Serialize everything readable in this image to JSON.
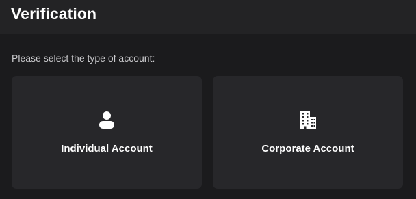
{
  "header": {
    "title": "Verification"
  },
  "prompt": "Please select the type of account:",
  "options": [
    {
      "label": "Individual Account",
      "icon": "person-icon"
    },
    {
      "label": "Corporate Account",
      "icon": "building-icon"
    }
  ],
  "colors": {
    "background": "#1b1b1d",
    "header": "#232325",
    "card": "#27272a",
    "text": "#ffffff",
    "muted_text": "#c9c9cc"
  }
}
